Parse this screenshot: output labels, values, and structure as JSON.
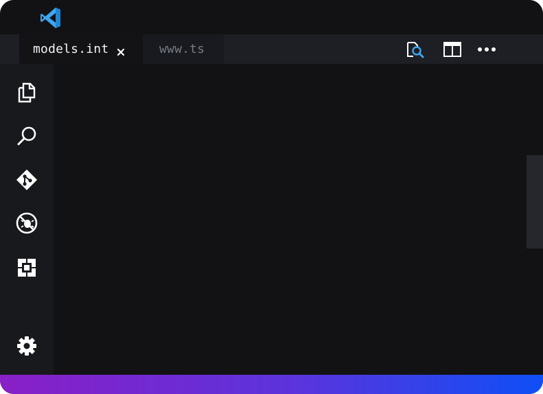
{
  "app": {
    "logo_icon": "vscode-logo-icon",
    "accent_color": "#3ea7f0"
  },
  "tabs": [
    {
      "label": "models.int",
      "active": true,
      "close_icon": "close-icon"
    },
    {
      "label": "www.ts",
      "active": false
    }
  ],
  "toolbar": {
    "icons": [
      "search-file-icon",
      "split-editor-icon",
      "more-actions-icon"
    ]
  },
  "activity_bar": {
    "items": [
      "explorer-icon",
      "search-icon",
      "source-control-icon",
      "debug-icon",
      "extensions-icon"
    ],
    "bottom": [
      "settings-gear-icon"
    ]
  },
  "status_bar": {
    "gradient": [
      "#8a1fc7",
      "#5a34dc",
      "#0f4ff6"
    ]
  }
}
